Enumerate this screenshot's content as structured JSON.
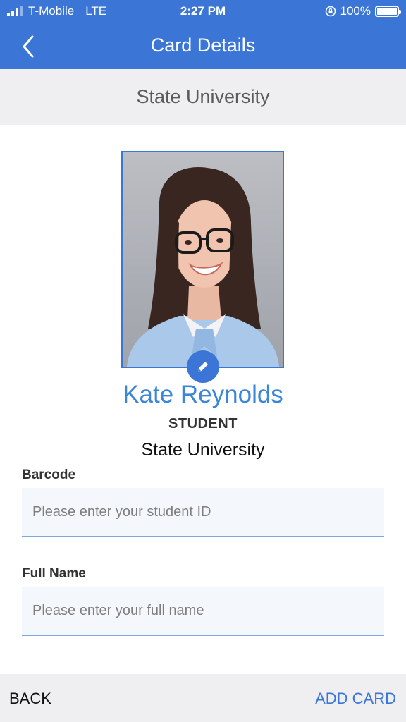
{
  "status_bar": {
    "carrier": "T-Mobile",
    "network": "LTE",
    "time": "2:27 PM",
    "battery": "100%"
  },
  "nav": {
    "title": "Card Details",
    "back_icon": "chevron-left-icon"
  },
  "subheader": {
    "title": "State University"
  },
  "profile": {
    "name": "Kate Reynolds",
    "role": "STUDENT",
    "school": "State University",
    "edit_icon": "pencil-icon"
  },
  "form": {
    "barcode": {
      "label": "Barcode",
      "placeholder": "Please enter your student ID",
      "value": ""
    },
    "full_name": {
      "label": "Full Name",
      "placeholder": "Please enter your full name",
      "value": ""
    }
  },
  "bottom_bar": {
    "back_label": "BACK",
    "add_label": "ADD CARD"
  },
  "colors": {
    "primary": "#3b76d6",
    "name_accent": "#3b86d6",
    "background_gray": "#efeff1"
  }
}
